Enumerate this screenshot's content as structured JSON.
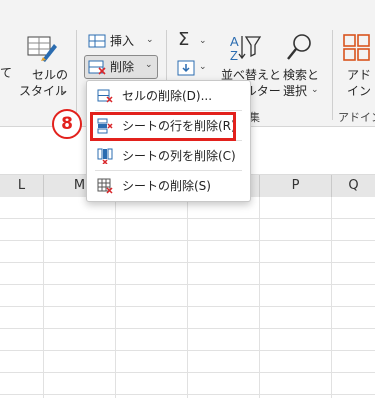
{
  "ribbon": {
    "styles_group": {
      "format_table_label_partial": "て",
      "cell_style_label_line1": "セルの",
      "cell_style_label_line2": "スタイル"
    },
    "cells_group": {
      "insert_label": "挿入",
      "delete_label": "削除",
      "group_label_partial": "集"
    },
    "editing_group": {
      "sort_filter_label_line1": "並べ替えと",
      "sort_filter_label_line2": "フィルター",
      "find_select_label_line1": "検索と",
      "find_select_label_line2": "選択",
      "sigma_symbol": "Σ"
    },
    "addins_group": {
      "addin_label_line1": "アド",
      "addin_label_line2": "イン",
      "group_label": "アドイン"
    }
  },
  "delete_menu": {
    "items": [
      {
        "label": "セルの削除(D)...",
        "icon": "delete-cells-icon"
      },
      {
        "label": "シートの行を削除(R)",
        "icon": "delete-sheet-rows-icon"
      },
      {
        "label": "シートの列を削除(C)",
        "icon": "delete-sheet-columns-icon"
      },
      {
        "label": "シートの削除(S)",
        "icon": "delete-sheet-icon"
      }
    ],
    "highlighted_index": 1
  },
  "annotation": {
    "step_number": "8",
    "color": "#e2211c"
  },
  "sheet": {
    "column_headers": [
      "L",
      "M",
      "N",
      "O",
      "P",
      "Q"
    ]
  },
  "colors": {
    "ribbon_bg": "#f3f3f3",
    "accent_red": "#e2211c",
    "icon_blue": "#2b6cb0",
    "header_bg": "#e6e6e6"
  }
}
